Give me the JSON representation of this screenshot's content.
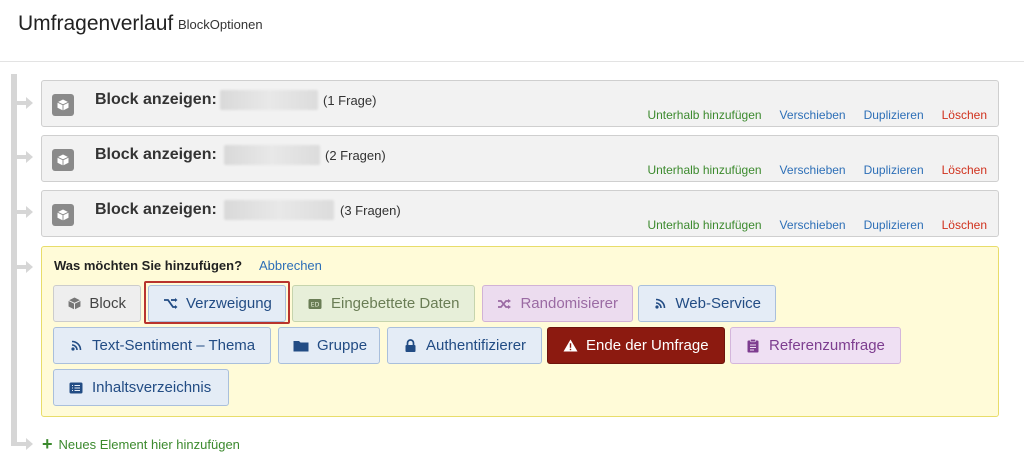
{
  "header": {
    "title": "Umfragenverlauf",
    "subtitle": "BlockOptionen"
  },
  "blocks": [
    {
      "title": "Block anzeigen:",
      "count": "(1 Frage)"
    },
    {
      "title": "Block anzeigen:",
      "count": "(2 Fragen)"
    },
    {
      "title": "Block anzeigen:",
      "count": "(3 Fragen)"
    }
  ],
  "block_actions": {
    "add_below": "Unterhalb hinzufügen",
    "move": "Verschieben",
    "duplicate": "Duplizieren",
    "delete": "Löschen"
  },
  "add_panel": {
    "question": "Was möchten Sie hinzufügen?",
    "cancel": "Abbrechen",
    "options": {
      "block": "Block",
      "branch": "Verzweigung",
      "embedded_data": "Eingebettete Daten",
      "randomizer": "Randomisierer",
      "web_service": "Web-Service",
      "text_sentiment": "Text-Sentiment – Thema",
      "group": "Gruppe",
      "authenticator": "Authentifizierer",
      "end_of_survey": "Ende der Umfrage",
      "reference_survey": "Referenzumfrage",
      "table_of_contents": "Inhaltsverzeichnis"
    }
  },
  "new_element": "Neues Element hier hinzufügen",
  "colors": {
    "accent_red": "#8c1a10",
    "link_blue": "#2d6fb7",
    "link_green": "#3c8a2e",
    "delete_red": "#d0311d",
    "highlight": "#b8332d"
  }
}
